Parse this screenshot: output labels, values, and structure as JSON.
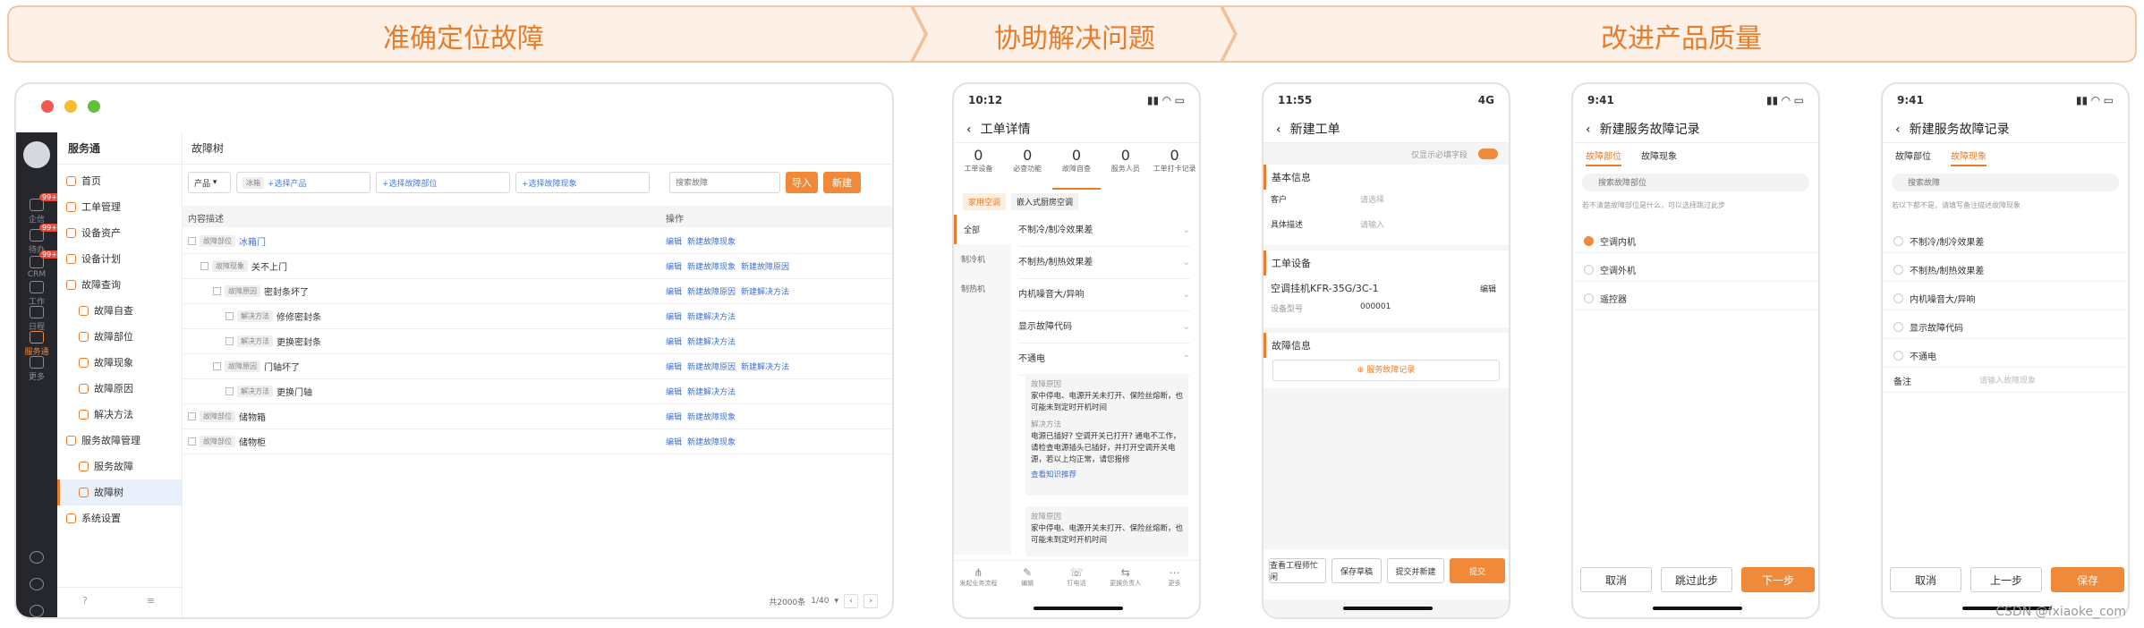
{
  "banner": {
    "stage1": "准确定位故障",
    "stage2": "协助解决问题",
    "stage3": "改进产品质量"
  },
  "colors": {
    "accent": "#f08a3a",
    "text_accent": "#e87c2a",
    "link": "#3b6fd6",
    "dark_sidebar": "#25272d"
  },
  "desktop": {
    "app_name": "服务通",
    "rail": [
      {
        "label": "企信",
        "badge": "99+"
      },
      {
        "label": "待办",
        "badge": "99+"
      },
      {
        "label": "CRM",
        "badge": "99+"
      },
      {
        "label": "工作",
        "badge": ""
      },
      {
        "label": "日程",
        "badge": ""
      },
      {
        "label": "服务通",
        "badge": ""
      },
      {
        "label": "更多",
        "badge": ""
      }
    ],
    "nav": [
      "首页",
      "工单管理",
      "设备资产",
      "设备计划",
      "故障查询",
      "故障自查",
      "故障部位",
      "故障现象",
      "故障原因",
      "解决方法",
      "服务故障管理",
      "服务故障",
      "故障树",
      "系统设置"
    ],
    "page_title": "故障树",
    "filter": {
      "product": "产品",
      "chip": "冰箱",
      "select_product": "+选择产品",
      "select_part": "+选择故障部位",
      "select_symptom": "+选择故障现象",
      "search_placeholder": "搜索故障",
      "import": "导入",
      "new": "新建"
    },
    "table": {
      "col1": "内容描述",
      "col2": "操作",
      "rows": [
        {
          "tag": "故障部位",
          "text": "冰箱门",
          "ops": [
            "编辑",
            "新建故障现象"
          ]
        },
        {
          "tag": "故障现象",
          "text": "关不上门",
          "ops": [
            "编辑",
            "新建故障现象",
            "新建故障原因"
          ]
        },
        {
          "tag": "故障原因",
          "text": "密封条坏了",
          "ops": [
            "编辑",
            "新建故障原因",
            "新建解决方法"
          ]
        },
        {
          "tag": "解决方法",
          "text": "修修密封条",
          "ops": [
            "编辑",
            "新建解决方法"
          ]
        },
        {
          "tag": "解决方法",
          "text": "更换密封条",
          "ops": [
            "编辑",
            "新建解决方法"
          ]
        },
        {
          "tag": "故障原因",
          "text": "门轴坏了",
          "ops": [
            "编辑",
            "新建故障原因",
            "新建解决方法"
          ]
        },
        {
          "tag": "解决方法",
          "text": "更换门轴",
          "ops": [
            "编辑",
            "新建解决方法"
          ]
        },
        {
          "tag": "故障部位",
          "text": "储物箱",
          "ops": [
            "编辑",
            "新建故障现象"
          ]
        },
        {
          "tag": "故障部位",
          "text": "储物柜",
          "ops": [
            "编辑",
            "新建故障现象"
          ]
        }
      ]
    },
    "pager": {
      "total": "共2000条",
      "page": "1/40"
    }
  },
  "phone1": {
    "time": "10:12",
    "title": "工单详情",
    "stats": [
      {
        "n": "0",
        "l": "工单设备"
      },
      {
        "n": "0",
        "l": "必查功能"
      },
      {
        "n": "0",
        "l": "故障自查"
      },
      {
        "n": "0",
        "l": "服务人员"
      },
      {
        "n": "0",
        "l": "工单打卡记录"
      }
    ],
    "tabs": [
      "家用空调",
      "嵌入式厨房空调"
    ],
    "left": [
      "全部",
      "制冷机",
      "制热机"
    ],
    "items": [
      "不制冷/制冷效果差",
      "不制热/制热效果差",
      "内机噪音大/异响",
      "显示故障代码",
      "不通电"
    ],
    "cause_label": "故障原因",
    "cause_text": "家中停电、电源开关未打开、保险丝熔断，也可能未到定时开机时间",
    "method_label": "解决方法",
    "method_text": "电源已插好? 空调开关已打开? 通电不工作，请检查电源插头已插好，并打开空调开关电源，若以上均正常，请您报修",
    "link": "查看知识推荐",
    "cause2_text": "家中停电、电源开关未打开、保险丝熔断，也可能未到定时开机时间",
    "tabbar": [
      "发起业务流程",
      "编辑",
      "打电话",
      "更换负责人",
      "更多"
    ]
  },
  "phone2": {
    "time": "11:55",
    "signal": "4G",
    "title": "新建工单",
    "toggle_label": "仅显示必填字段",
    "sec1": "基本信息",
    "customer": "客户",
    "customer_ph": "请选择",
    "detail": "具体描述",
    "detail_ph": "请输入",
    "sec2": "工单设备",
    "device": "空调挂机KFR-35G/3C-1",
    "edit": "编辑",
    "model_label": "设备型号",
    "model": "000001",
    "sec3": "故障信息",
    "add": "服务故障记录",
    "btns": [
      "查看工程师忙闲",
      "保存草稿",
      "提交并新建",
      "提交"
    ]
  },
  "phone3": {
    "time": "9:41",
    "title": "新建服务故障记录",
    "tabs": [
      "故障部位",
      "故障现象"
    ],
    "search_ph": "搜索故障部位",
    "hint": "若不清楚故障部位是什么，可以选择跳过此步",
    "options": [
      "空调内机",
      "空调外机",
      "遥控器"
    ],
    "btns": [
      "取消",
      "跳过此步",
      "下一步"
    ]
  },
  "phone4": {
    "time": "9:41",
    "title": "新建服务故障记录",
    "tabs": [
      "故障部位",
      "故障现象"
    ],
    "search_ph": "搜索故障",
    "hint": "若以下都不是，请填写备注描述故障现象",
    "options": [
      "不制冷/制冷效果差",
      "不制热/制热效果差",
      "内机噪音大/异响",
      "显示故障代码",
      "不通电"
    ],
    "remark": "备注",
    "remark_ph": "请输入故障现象",
    "btns": [
      "取消",
      "上一步",
      "保存"
    ]
  },
  "watermark": "CSDN @fxiaoke_com"
}
